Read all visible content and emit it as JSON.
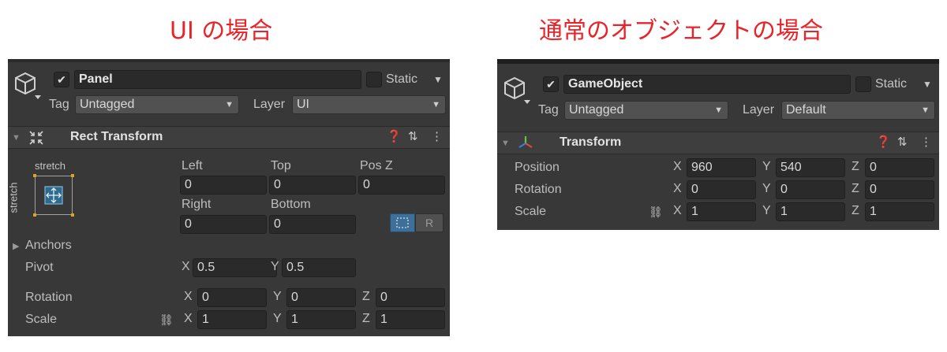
{
  "left_title": "UI の場合",
  "right_title": "通常のオブジェクトの場合",
  "ui": {
    "name": "Panel",
    "static_label": "Static",
    "tag_label": "Tag",
    "tag_value": "Untagged",
    "layer_label": "Layer",
    "layer_value": "UI",
    "component_title": "Rect Transform",
    "anchor_top": "stretch",
    "anchor_side": "stretch",
    "left_label": "Left",
    "top_label": "Top",
    "posz_label": "Pos Z",
    "left_value": "0",
    "top_value": "0",
    "posz_value": "0",
    "right_label": "Right",
    "bottom_label": "Bottom",
    "right_value": "0",
    "bottom_value": "0",
    "r_button": "R",
    "anchors_label": "Anchors",
    "pivot_label": "Pivot",
    "pivot_x": "0.5",
    "pivot_y": "0.5",
    "rotation_label": "Rotation",
    "rotation": {
      "x": "0",
      "y": "0",
      "z": "0"
    },
    "scale_label": "Scale",
    "scale": {
      "x": "1",
      "y": "1",
      "z": "1"
    },
    "axis": {
      "x": "X",
      "y": "Y",
      "z": "Z"
    }
  },
  "normal": {
    "name": "GameObject",
    "static_label": "Static",
    "tag_label": "Tag",
    "tag_value": "Untagged",
    "layer_label": "Layer",
    "layer_value": "Default",
    "component_title": "Transform",
    "position_label": "Position",
    "position": {
      "x": "960",
      "y": "540",
      "z": "0"
    },
    "rotation_label": "Rotation",
    "rotation": {
      "x": "0",
      "y": "0",
      "z": "0"
    },
    "scale_label": "Scale",
    "scale": {
      "x": "1",
      "y": "1",
      "z": "1"
    },
    "axis": {
      "x": "X",
      "y": "Y",
      "z": "Z"
    }
  },
  "icons": [
    "cube-icon",
    "checkmark-icon",
    "dropdown-caret-icon",
    "rect-transform-icon",
    "transform-axes-icon",
    "help-icon",
    "preset-sliders-icon",
    "kebab-menu-icon",
    "link-icon",
    "anchor-preset-icon",
    "blueprint-mode-icon",
    "foldout-triangle-icon"
  ],
  "colors": {
    "title": "#e8242a",
    "panel_bg": "#383838",
    "field_bg": "#2a2a2a",
    "active_button": "#3d6f99"
  }
}
